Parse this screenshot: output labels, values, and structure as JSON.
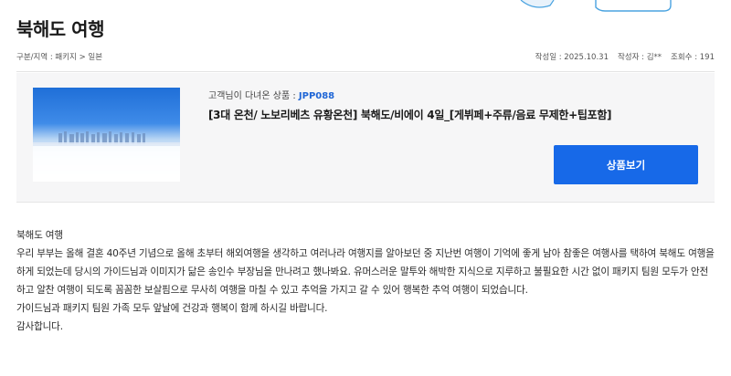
{
  "page": {
    "title": "북해도 여행",
    "breadcrumb": "구분/지역 : 패키지 > 일본"
  },
  "meta": {
    "date": "작성일 : 2025.10.31",
    "author": "작성자 : 김**",
    "views": "조회수 : 191"
  },
  "product": {
    "guest_label": "고객님이 다녀온 상품 : ",
    "product_code": "JPP088",
    "name": "[3대 온천/ 노보리베츠 유황온천] 북해도/비에이 4일_[게뷔페+주류/음료 무제한+팁포함]",
    "view_button": "상품보기"
  },
  "review": {
    "paragraphs": [
      "북해도 여행",
      "우리 부부는 올해 결혼 40주년 기념으로 올해 초부터 해외여행을 생각하고 여러나라 여행지를 알아보던 중 지난번 여행이 기억에 좋게 남아 참좋은 여행사를 택하여 북해도 여행을 하게 되었는데 당시의 가이드님과 이미지가 닮은 송인수 부장님을 만나려고 했나봐요. 유머스러운 말투와 해박한 지식으로 지루하고 불필요한 시간 없이 패키지 팀원 모두가 안전하고 알찬 여행이 되도록 꼼꼼한 보살핌으로 무사히 여행을 마칠 수 있고 추억을 가지고 갈 수 있어 행복한 추억 여행이 되었습니다.",
      "가이드님과 패키지 팀원 가족 모두 앞날에 건강과 행복이 함께 하시길 바랍니다.",
      "감사합니다."
    ]
  },
  "colors": {
    "accent": "#1769e8",
    "code": "#1f66d6"
  }
}
